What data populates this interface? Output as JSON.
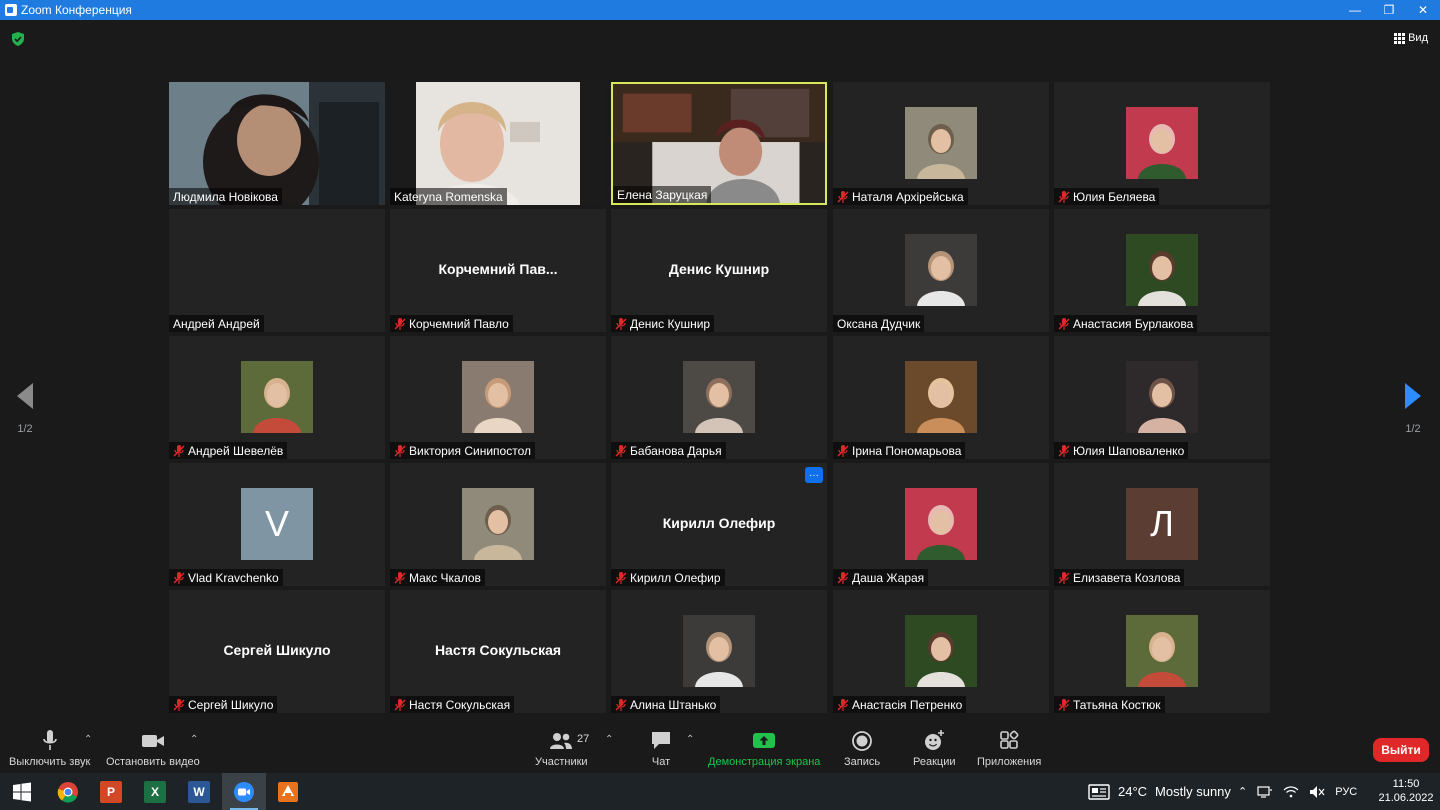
{
  "window": {
    "title": "Zoom Конференция",
    "minimize": "—",
    "maximize": "❐",
    "close": "✕"
  },
  "top": {
    "view_label": "Вид"
  },
  "colors": {
    "accent": "#1f7be0",
    "speaker_border": "#d7e85a",
    "leave": "#e02828",
    "share_green": "#21c14b"
  },
  "participants": [
    {
      "name": "Людмила Новікова",
      "muted": false,
      "type": "video"
    },
    {
      "name": "Kateryna Romenska",
      "muted": false,
      "type": "video"
    },
    {
      "name": "Елена Заруцкая",
      "muted": false,
      "type": "video",
      "speaker": true
    },
    {
      "name": "Наталя Архірейська",
      "muted": true,
      "type": "photo"
    },
    {
      "name": "Юлия Беляева",
      "muted": true,
      "type": "photo"
    },
    {
      "name": "Андрей Андрей",
      "muted": false,
      "type": "blank"
    },
    {
      "name": "Корчемний Павло",
      "display": "Корчемний  Пав...",
      "muted": true,
      "type": "text"
    },
    {
      "name": "Денис Кушнир",
      "display": "Денис Кушнир",
      "muted": true,
      "type": "text"
    },
    {
      "name": "Оксана Дудчик",
      "muted": false,
      "type": "photo"
    },
    {
      "name": "Анастасия Бурлакова",
      "muted": true,
      "type": "photo"
    },
    {
      "name": "Андрей Шевелёв",
      "muted": true,
      "type": "photo"
    },
    {
      "name": "Виктория Синипостол",
      "muted": true,
      "type": "photo"
    },
    {
      "name": "Бабанова Дарья",
      "muted": true,
      "type": "photo"
    },
    {
      "name": "Ірина Пономарьова",
      "muted": true,
      "type": "photo"
    },
    {
      "name": "Юлия Шаповаленко",
      "muted": true,
      "type": "photo"
    },
    {
      "name": "Vlad Kravchenko",
      "letter": "V",
      "muted": true,
      "type": "letter",
      "letter_color": "#7f95a3"
    },
    {
      "name": "Макс Чкалов",
      "muted": true,
      "type": "photo"
    },
    {
      "name": "Кирилл Олефир",
      "display": "Кирилл Олефир",
      "muted": true,
      "type": "text",
      "more": "···"
    },
    {
      "name": "Даша Жарая",
      "muted": true,
      "type": "photo"
    },
    {
      "name": "Елизавета Козлова",
      "letter": "Л",
      "muted": true,
      "type": "letter",
      "letter_color": "#5c3d33"
    },
    {
      "name": "Сергей Шикуло",
      "display": "Сергей Шикуло",
      "muted": true,
      "type": "text"
    },
    {
      "name": "Настя Сокульская",
      "display": "Настя Сокульская",
      "muted": true,
      "type": "text"
    },
    {
      "name": "Алина Штанько",
      "muted": true,
      "type": "photo"
    },
    {
      "name": "Анастасія Петренко",
      "muted": true,
      "type": "photo"
    },
    {
      "name": "Татьяна Костюк",
      "muted": true,
      "type": "photo"
    }
  ],
  "pager": {
    "left": "1/2",
    "right": "1/2"
  },
  "toolbar": {
    "mute": "Выключить звук",
    "video": "Остановить видео",
    "participants": "Участники",
    "participants_count": "27",
    "chat": "Чат",
    "share": "Демонстрация экрана",
    "record": "Запись",
    "reactions": "Реакции",
    "apps": "Приложения",
    "leave": "Выйти"
  },
  "taskbar": {
    "apps": [
      "windows-start",
      "chrome",
      "powerpoint",
      "excel",
      "word",
      "zoom",
      "other-app"
    ],
    "temperature": "24°C",
    "weather": "Mostly sunny",
    "language": "РУС",
    "time": "11:50",
    "date": "21.06.2022"
  }
}
